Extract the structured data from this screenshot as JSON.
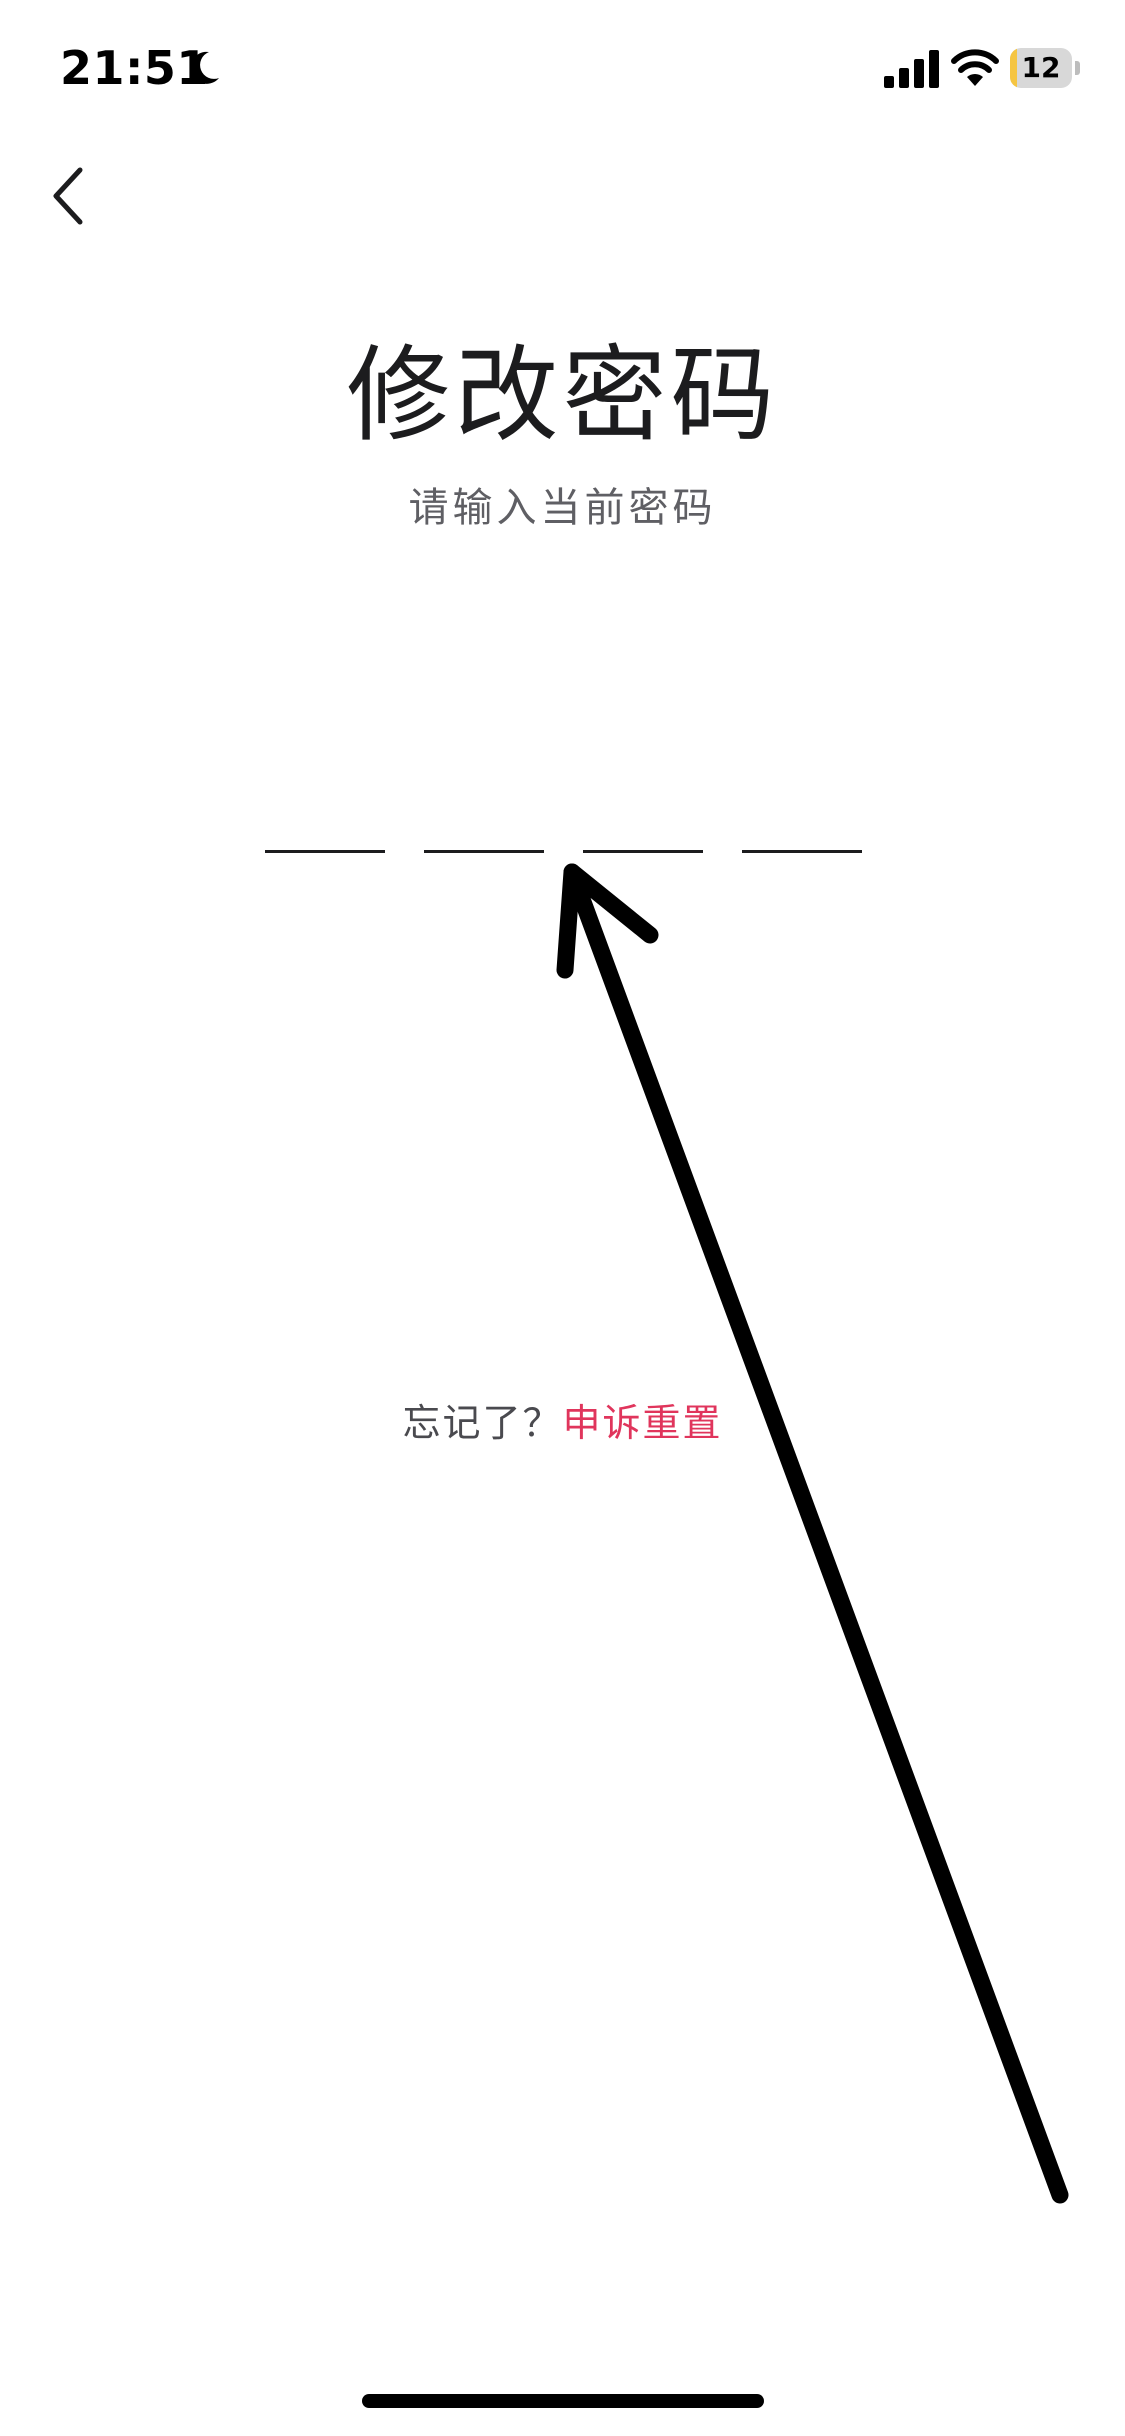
{
  "status_bar": {
    "time": "21:51",
    "battery_level": "12",
    "battery_fraction": 0.12
  },
  "nav": {
    "back_icon": "chevron-left-icon"
  },
  "header": {
    "title": "修改密码",
    "subtitle": "请输入当前密码"
  },
  "pin": {
    "length": 4,
    "entered": 0
  },
  "forgot": {
    "prompt": "忘记了？",
    "link_label": "申诉重置"
  },
  "colors": {
    "accent": "#e0355c",
    "text_primary": "#1c1c1e",
    "text_secondary": "#5f5f64",
    "battery_fill": "#f5c542"
  },
  "icons": [
    "moon-icon",
    "signal-icon",
    "wifi-icon",
    "battery-icon",
    "chevron-left-icon",
    "arrow-annotation"
  ]
}
